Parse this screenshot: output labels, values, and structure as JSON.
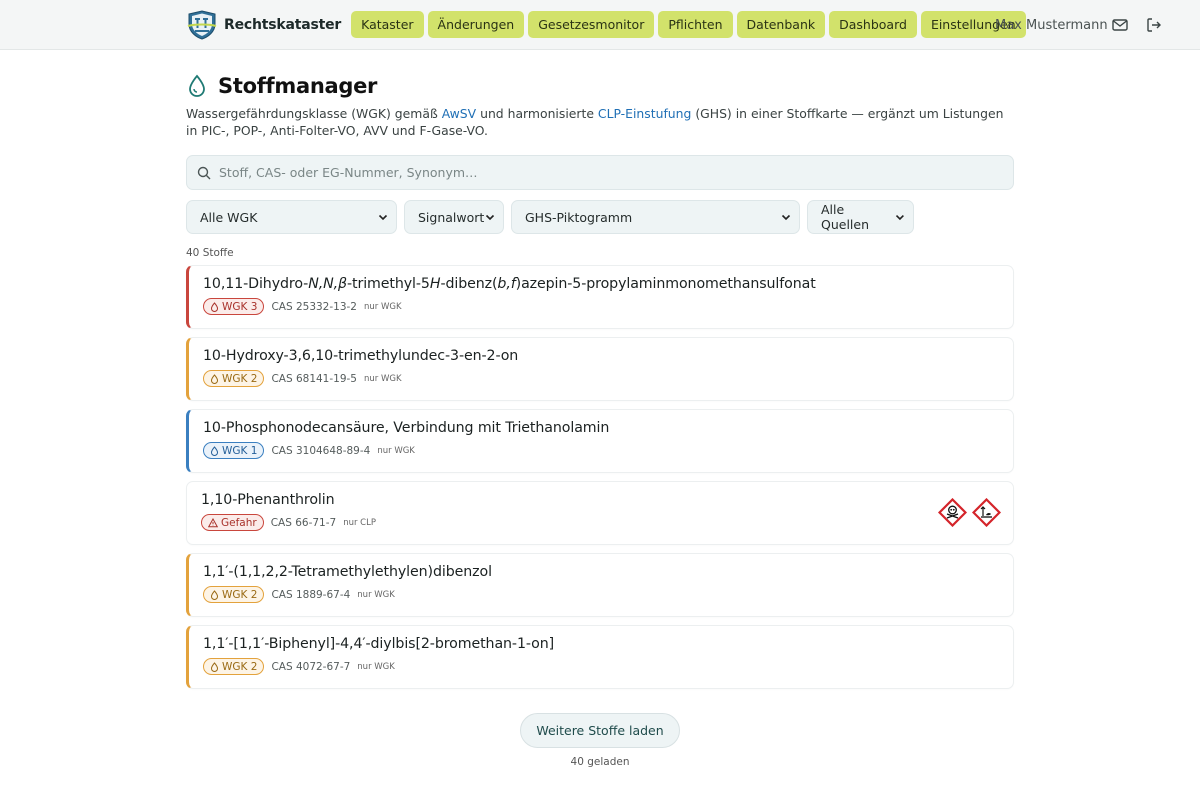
{
  "header": {
    "brand": "Rechtskataster",
    "nav": [
      "Kataster",
      "Änderungen",
      "Gesetzesmonitor",
      "Pflichten",
      "Datenbank",
      "Dashboard",
      "Einstellungen"
    ],
    "user": "Max Mustermann"
  },
  "page": {
    "title": "Stoffmanager",
    "desc_1": "Wassergefährdungsklasse (WGK) gemäß ",
    "desc_link1": "AwSV",
    "desc_2": " und harmonisierte ",
    "desc_link2": "CLP-Einstufung",
    "desc_3": " (GHS) in einer Stoffkarte — ergänzt um Listungen in PIC-, POP-, Anti-Folter-VO, AVV und F-Gase-VO."
  },
  "search": {
    "placeholder": "Stoff, CAS- oder EG-Nummer, Synonym…"
  },
  "filters": {
    "wgk": "Alle WGK",
    "signal": "Signalwort",
    "ghs": "GHS-Piktogramm",
    "sources": "Alle Quellen"
  },
  "count": "40 Stoffe",
  "colors": {
    "wgk3": "#c9463d",
    "wgk2": "#e3a23c",
    "wgk1": "#3a7fc0",
    "danger": "#c9463d",
    "accent_nav": "#d2e26b"
  },
  "cards": [
    {
      "name": "10,11-Dihydro-N,N,β-trimethyl-5H-dibenz(b,f)azepin-5-propylaminmonomethansulfonat",
      "badge": "WGK 3",
      "cas": "CAS 25332-13-2",
      "source": "nur WGK",
      "level": "wgk3"
    },
    {
      "name": "10-Hydroxy-3,6,10-trimethylundec-3-en-2-on",
      "badge": "WGK 2",
      "cas": "CAS 68141-19-5",
      "source": "nur WGK",
      "level": "wgk2"
    },
    {
      "name": "10-Phosphonodecansäure, Verbindung mit Triethanolamin",
      "badge": "WGK 1",
      "cas": "CAS 3104648-89-4",
      "source": "nur WGK",
      "level": "wgk1"
    },
    {
      "name": "1,10-Phenanthrolin",
      "badge": "Gefahr",
      "cas": "CAS 66-71-7",
      "source": "nur CLP",
      "level": "danger",
      "pictograms": [
        "skull-crossbones-pictogram",
        "environment-pictogram"
      ]
    },
    {
      "name": "1,1′-(1,1,2,2-Tetramethylethylen)dibenzol",
      "badge": "WGK 2",
      "cas": "CAS 1889-67-4",
      "source": "nur WGK",
      "level": "wgk2"
    },
    {
      "name": "1,1′-[1,1′-Biphenyl]-4,4′-diylbis[2-bromethan-1-on]",
      "badge": "WGK 2",
      "cas": "CAS 4072-67-7",
      "source": "nur WGK",
      "level": "wgk2"
    }
  ],
  "more_button": "Weitere Stoffe laden",
  "loaded": "40 geladen"
}
